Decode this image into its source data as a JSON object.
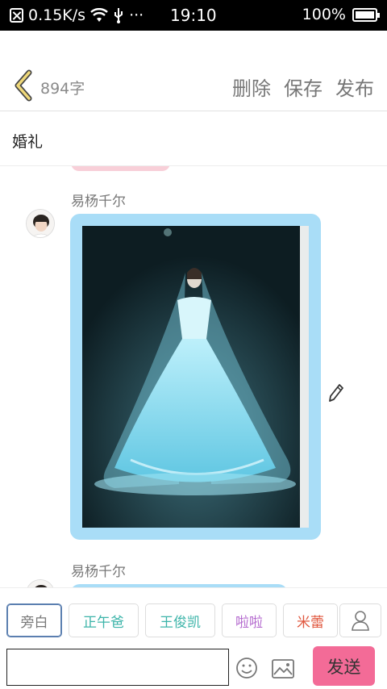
{
  "status_bar": {
    "network_speed": "0.15K/s",
    "time": "19:10",
    "battery": "100%",
    "more": "···"
  },
  "header": {
    "char_count": "894字",
    "delete_label": "删除",
    "save_label": "保存",
    "publish_label": "发布"
  },
  "title": "婚礼",
  "messages": [
    {
      "author": "易杨千尔",
      "type": "image"
    },
    {
      "author": "易杨千尔",
      "type": "text"
    }
  ],
  "roles": [
    "旁白",
    "正午爸",
    "王俊凯",
    "啦啦",
    "米蕾"
  ],
  "composer": {
    "input_value": "",
    "send_label": "发送"
  },
  "colors": {
    "bubble": "#a9ddf7",
    "send_button": "#f36b97",
    "role_teal": "#3cb4a9",
    "role_purple": "#b56ccf",
    "role_red": "#e0573e"
  },
  "icons": [
    "back-icon",
    "edit-icon",
    "emoji-icon",
    "image-icon",
    "person-icon",
    "wifi-icon",
    "usb-icon",
    "battery-icon"
  ]
}
